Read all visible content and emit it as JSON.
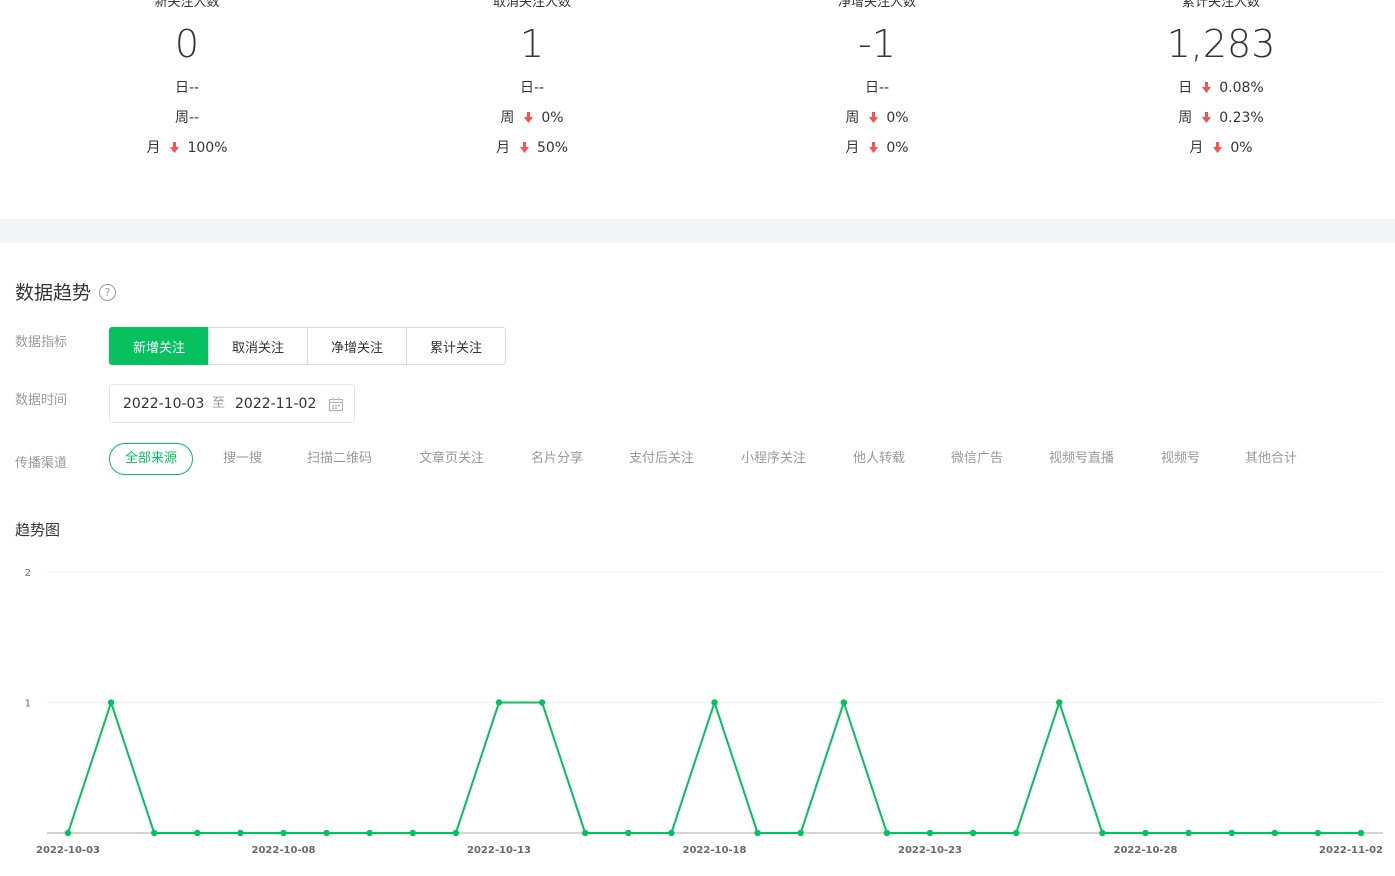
{
  "stats": [
    {
      "label": "新关注人数",
      "value": "0",
      "day": {
        "k": "日",
        "v": "--",
        "trend": ""
      },
      "week": {
        "k": "周",
        "v": "--",
        "trend": ""
      },
      "month": {
        "k": "月",
        "v": "100%",
        "trend": "down"
      }
    },
    {
      "label": "取消关注人数",
      "value": "1",
      "day": {
        "k": "日",
        "v": "--",
        "trend": ""
      },
      "week": {
        "k": "周",
        "v": "0%",
        "trend": "down"
      },
      "month": {
        "k": "月",
        "v": "50%",
        "trend": "down"
      }
    },
    {
      "label": "净增关注人数",
      "value": "-1",
      "day": {
        "k": "日",
        "v": "--",
        "trend": ""
      },
      "week": {
        "k": "周",
        "v": "0%",
        "trend": "down"
      },
      "month": {
        "k": "月",
        "v": "0%",
        "trend": "down"
      }
    },
    {
      "label": "累计关注人数",
      "value": "1,283",
      "day": {
        "k": "日",
        "v": "0.08%",
        "trend": "down"
      },
      "week": {
        "k": "周",
        "v": "0.23%",
        "trend": "down"
      },
      "month": {
        "k": "月",
        "v": "0%",
        "trend": "down"
      }
    }
  ],
  "trend": {
    "title": "数据趋势",
    "help_symbol": "?",
    "metric_label": "数据指标",
    "metrics": [
      "新增关注",
      "取消关注",
      "净增关注",
      "累计关注"
    ],
    "active_metric": 0,
    "time_label": "数据时间",
    "date_from": "2022-10-03",
    "date_sep": "至",
    "date_to": "2022-11-02",
    "channel_label": "传播渠道",
    "channels": [
      "全部来源",
      "搜一搜",
      "扫描二维码",
      "文章页关注",
      "名片分享",
      "支付后关注",
      "小程序关注",
      "他人转载",
      "微信广告",
      "视频号直播",
      "视频号",
      "其他合计"
    ],
    "active_channel": 0,
    "chart_title": "趋势图"
  },
  "colors": {
    "accent": "#07c160",
    "down_arrow": "#fa5151",
    "muted_text": "#9a9a9a"
  },
  "chart_data": {
    "type": "line",
    "x": [
      "2022-10-03",
      "2022-10-04",
      "2022-10-05",
      "2022-10-06",
      "2022-10-07",
      "2022-10-08",
      "2022-10-09",
      "2022-10-10",
      "2022-10-11",
      "2022-10-12",
      "2022-10-13",
      "2022-10-14",
      "2022-10-15",
      "2022-10-16",
      "2022-10-17",
      "2022-10-18",
      "2022-10-19",
      "2022-10-20",
      "2022-10-21",
      "2022-10-22",
      "2022-10-23",
      "2022-10-24",
      "2022-10-25",
      "2022-10-26",
      "2022-10-27",
      "2022-10-28",
      "2022-10-29",
      "2022-10-30",
      "2022-10-31",
      "2022-11-01",
      "2022-11-02"
    ],
    "series": [
      {
        "values": [
          0,
          1,
          0,
          0,
          0,
          0,
          0,
          0,
          0,
          0,
          1,
          1,
          0,
          0,
          0,
          1,
          0,
          0,
          1,
          0,
          0,
          0,
          0,
          1,
          0,
          0,
          0,
          0,
          0,
          0,
          0
        ]
      }
    ],
    "xticks": [
      "2022-10-03",
      "2022-10-08",
      "2022-10-13",
      "2022-10-18",
      "2022-10-23",
      "2022-10-28",
      "2022-11-02"
    ],
    "yticks": [
      "1",
      "2"
    ],
    "ylim": [
      0,
      2
    ],
    "grid": true,
    "color": "#07c160"
  }
}
